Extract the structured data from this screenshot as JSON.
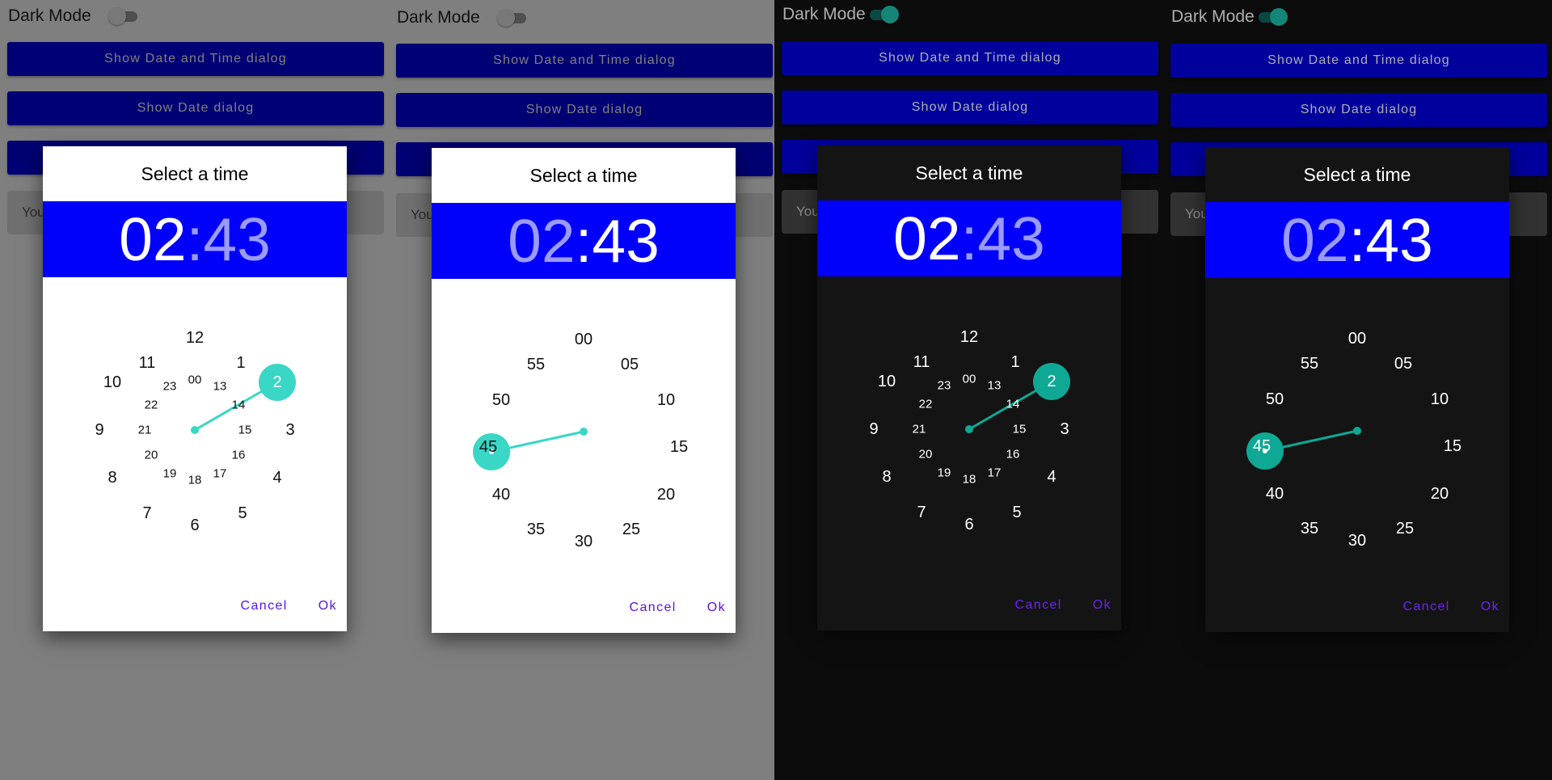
{
  "screens": [
    {
      "theme": "light",
      "dark_mode_label": "Dark Mode",
      "dark_mode_switch": "off",
      "buttons": {
        "date_time": "Show Date and Time dialog",
        "date": "Show Date dialog",
        "time": ""
      },
      "field_text": "You",
      "dialog": {
        "title": "Select a time",
        "hour": "02",
        "separator": ":",
        "minute": "43",
        "active_part": "hour",
        "clock_mode": "hours",
        "selected": "2",
        "cancel_label": "Cancel",
        "ok_label": "Ok"
      }
    },
    {
      "theme": "light",
      "dark_mode_label": "Dark Mode",
      "dark_mode_switch": "off",
      "buttons": {
        "date_time": "Show Date and Time dialog",
        "date": "Show Date dialog",
        "time": ""
      },
      "field_text": "You",
      "dialog": {
        "title": "Select a time",
        "hour": "02",
        "separator": ":",
        "minute": "43",
        "active_part": "minute",
        "clock_mode": "minutes",
        "selected_minute": 43,
        "cancel_label": "Cancel",
        "ok_label": "Ok"
      }
    },
    {
      "theme": "dark",
      "dark_mode_label": "Dark Mode",
      "dark_mode_switch": "on",
      "buttons": {
        "date_time": "Show Date and Time dialog",
        "date": "Show Date dialog",
        "time": ""
      },
      "field_text": "You",
      "dialog": {
        "title": "Select a time",
        "hour": "02",
        "separator": ":",
        "minute": "43",
        "active_part": "hour",
        "clock_mode": "hours",
        "selected": "2",
        "cancel_label": "Cancel",
        "ok_label": "Ok"
      }
    },
    {
      "theme": "dark",
      "dark_mode_label": "Dark Mode",
      "dark_mode_switch": "on",
      "buttons": {
        "date_time": "Show Date and Time dialog",
        "date": "Show Date dialog",
        "time": ""
      },
      "field_text": "You",
      "dialog": {
        "title": "Select a time",
        "hour": "02",
        "separator": ":",
        "minute": "43",
        "active_part": "minute",
        "clock_mode": "minutes",
        "selected_minute": 43,
        "cancel_label": "Cancel",
        "ok_label": "Ok"
      }
    }
  ],
  "clock": {
    "hours_outer": [
      "12",
      "1",
      "2",
      "3",
      "4",
      "5",
      "6",
      "7",
      "8",
      "9",
      "10",
      "11"
    ],
    "hours_inner": [
      "00",
      "13",
      "14",
      "15",
      "16",
      "17",
      "18",
      "19",
      "20",
      "21",
      "22",
      "23"
    ],
    "minutes": [
      "00",
      "05",
      "10",
      "15",
      "20",
      "25",
      "30",
      "35",
      "40",
      "45",
      "50",
      "55"
    ]
  },
  "colors": {
    "button_blue": "#0000e8",
    "header_blue": "#0000fb",
    "accent_light": "#3ad6c6",
    "accent_dark": "#0fa894",
    "action_purple": "#5a13e8"
  }
}
